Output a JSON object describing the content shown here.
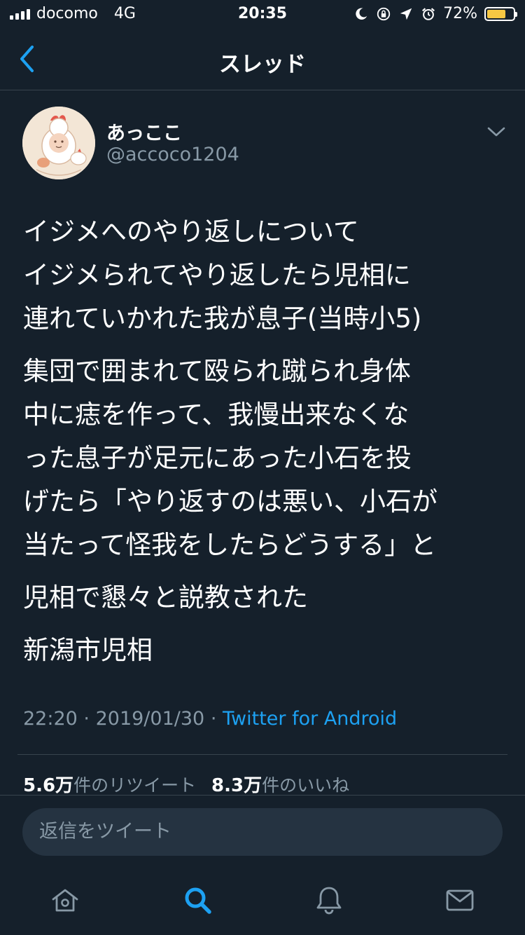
{
  "status_bar": {
    "carrier": "docomo",
    "network": "4G",
    "time": "20:35",
    "battery": "72%",
    "battery_level": 0.72,
    "battery_color": "#f7c843"
  },
  "header": {
    "title": "スレッド",
    "back_icon": "chevron-left-icon"
  },
  "tweet": {
    "author_name": "あっここ",
    "author_handle": "@accoco1204",
    "paragraphs": [
      "イジメへのやり返しについて\nイジメられてやり返したら児相に\n連れていかれた我が息子(当時小5)",
      "集団で囲まれて殴られ蹴られ身体\n中に痣を作って、我慢出来なくな\nった息子が足元にあった小石を投\nげたら「やり返すのは悪い、小石が\n当たって怪我をしたらどうする」と",
      "児相で懇々と説教された",
      "新潟市児相"
    ],
    "time": "22:20",
    "date": "2019/01/30",
    "separator": "·",
    "source": "Twitter for Android",
    "retweet_count": "5.6万",
    "retweet_label": "件のリツイート",
    "like_count": "8.3万",
    "like_label": "件のいいね"
  },
  "reply": {
    "placeholder": "返信をツイート"
  },
  "tabs": [
    {
      "name": "home",
      "icon": "home-icon"
    },
    {
      "name": "search",
      "icon": "search-icon",
      "active": true
    },
    {
      "name": "notifications",
      "icon": "bell-icon"
    },
    {
      "name": "messages",
      "icon": "mail-icon"
    }
  ],
  "colors": {
    "background": "#15202b",
    "accent": "#1da1f2",
    "secondary_text": "#8899a6",
    "divider": "#38444d"
  }
}
